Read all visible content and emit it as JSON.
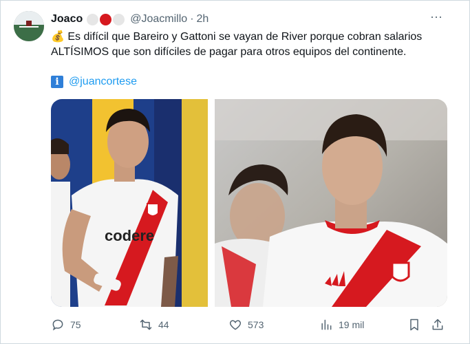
{
  "tweet": {
    "author_name": "Joaco",
    "handle": "@Joacmillo",
    "separator": "·",
    "time": "2h",
    "badge_colors": [
      "#e6e6e6",
      "#d6191f",
      "#e6e6e6"
    ],
    "text_line1": "💰 Es difícil que Bareiro y Gattoni se vayan de River porque cobran salarios",
    "text_line2": "ALTÍSIMOS que son difíciles de pagar para otros equipos del continente.",
    "info_icon_glyph": "i",
    "mention": "@juancortese",
    "more_icon": "···"
  },
  "media": {
    "left": {
      "description_icon": "player-photo",
      "shirt_sponsor": "codere"
    },
    "right": {
      "description_icon": "player-photo"
    }
  },
  "actions": {
    "reply_count": "75",
    "retweet_count": "44",
    "like_count": "573",
    "views_count": "19 mil"
  },
  "colors": {
    "text_primary": "#0f1419",
    "text_secondary": "#536471",
    "link": "#1d9bf0",
    "border": "#cfd9de",
    "river_red": "#d6191f"
  }
}
